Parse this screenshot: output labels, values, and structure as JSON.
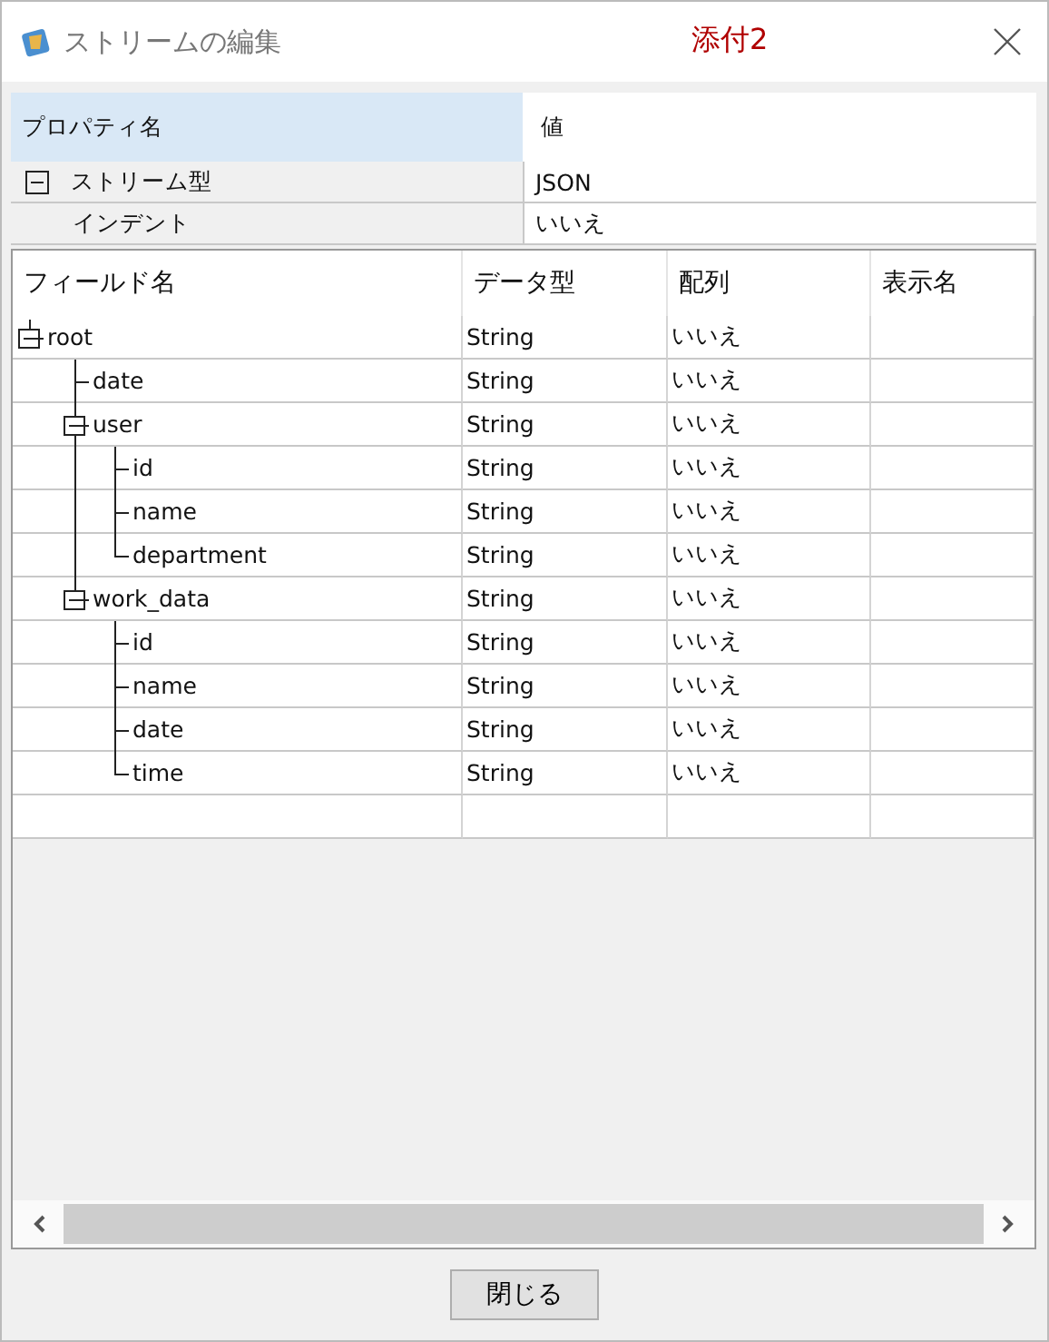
{
  "window": {
    "title": "ストリームの編集",
    "annotation": "添付2"
  },
  "property_grid": {
    "columns": [
      "プロパティ名",
      "値"
    ],
    "rows": [
      {
        "name": "ストリーム型",
        "value": "JSON",
        "expanded": true,
        "children": [
          {
            "name": "インデント",
            "value": "いいえ"
          }
        ]
      }
    ]
  },
  "field_table": {
    "columns": [
      "フィールド名",
      "データ型",
      "配列",
      "表示名"
    ],
    "rows": [
      {
        "name": "root",
        "type": "String",
        "array": "いいえ",
        "expanded": true,
        "children": [
          {
            "name": "date",
            "type": "String",
            "array": "いいえ"
          },
          {
            "name": "user",
            "type": "String",
            "array": "いいえ",
            "expanded": true,
            "children": [
              {
                "name": "id",
                "type": "String",
                "array": "いいえ"
              },
              {
                "name": "name",
                "type": "String",
                "array": "いいえ"
              },
              {
                "name": "department",
                "type": "String",
                "array": "いいえ"
              }
            ]
          },
          {
            "name": "work_data",
            "type": "String",
            "array": "いいえ",
            "expanded": true,
            "children": [
              {
                "name": "id",
                "type": "String",
                "array": "いいえ"
              },
              {
                "name": "name",
                "type": "String",
                "array": "いいえ"
              },
              {
                "name": "date",
                "type": "String",
                "array": "いいえ"
              },
              {
                "name": "time",
                "type": "String",
                "array": "いいえ"
              }
            ]
          }
        ]
      }
    ]
  },
  "buttons": [
    "閉じる"
  ]
}
